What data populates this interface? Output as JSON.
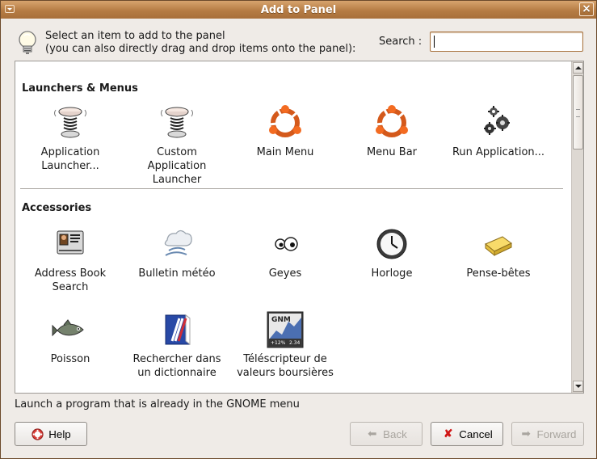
{
  "window": {
    "title": "Add to Panel"
  },
  "header": {
    "line1": "Select an item to add to the panel",
    "line2": "(you can also directly drag and drop items onto the panel):",
    "search_label": "Search :",
    "search_value": ""
  },
  "sections": [
    {
      "title": "Launchers & Menus",
      "items": [
        {
          "label": [
            "Application",
            "Launcher..."
          ],
          "icon": "launcher-spring-icon"
        },
        {
          "label": [
            "Custom",
            "Application",
            "Launcher"
          ],
          "icon": "launcher-spring-icon"
        },
        {
          "label": [
            "Main Menu"
          ],
          "icon": "ubuntu-logo-icon"
        },
        {
          "label": [
            "Menu Bar"
          ],
          "icon": "ubuntu-logo-icon"
        },
        {
          "label": [
            "Run Application..."
          ],
          "icon": "gears-icon"
        }
      ]
    },
    {
      "title": "Accessories",
      "items": [
        {
          "label": [
            "Address Book",
            "Search"
          ],
          "icon": "address-book-icon"
        },
        {
          "label": [
            "Bulletin météo"
          ],
          "icon": "weather-icon"
        },
        {
          "label": [
            "Geyes"
          ],
          "icon": "eyes-icon"
        },
        {
          "label": [
            "Horloge"
          ],
          "icon": "clock-icon"
        },
        {
          "label": [
            "Pense-bêtes"
          ],
          "icon": "sticky-notes-icon"
        },
        {
          "label": [
            "Poisson"
          ],
          "icon": "fish-icon"
        },
        {
          "label": [
            "Rechercher dans",
            "un dictionnaire"
          ],
          "icon": "dictionary-icon"
        },
        {
          "label": [
            "Téléscripteur de",
            "valeurs boursières"
          ],
          "icon": "stock-ticker-icon"
        }
      ]
    }
  ],
  "stock_icon": {
    "title": "GNM",
    "change": "+12%",
    "value": "2.34"
  },
  "status": "Launch a program that is already in the GNOME menu",
  "buttons": {
    "help": "Help",
    "back": "Back",
    "cancel": "Cancel",
    "forward": "Forward"
  },
  "colors": {
    "titlebar": "#b67c44",
    "accent": "#c85514",
    "panel": "#ffffff"
  }
}
